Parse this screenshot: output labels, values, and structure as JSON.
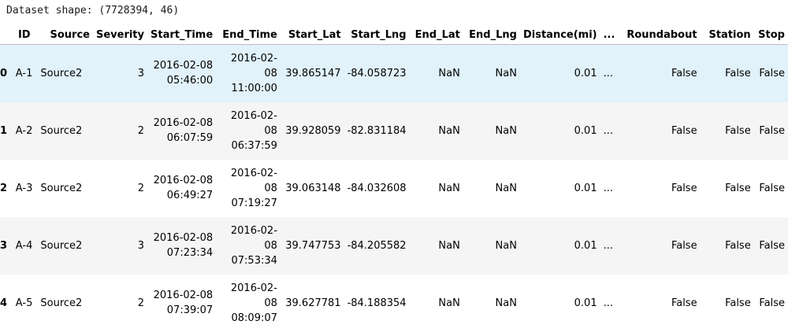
{
  "output": {
    "shape_text": "Dataset shape: (7728394, 46)"
  },
  "table": {
    "columns": [
      "",
      "ID",
      "Source",
      "Severity",
      "Start_Time",
      "End_Time",
      "Start_Lat",
      "Start_Lng",
      "End_Lat",
      "End_Lng",
      "Distance(mi)",
      "...",
      "Roundabout",
      "Station",
      "Stop"
    ],
    "rows": [
      {
        "index": "0",
        "cells": [
          "A-1",
          "Source2",
          "3",
          "2016-02-08 05:46:00",
          "2016-02-08 11:00:00",
          "39.865147",
          "-84.058723",
          "NaN",
          "NaN",
          "0.01",
          "...",
          "False",
          "False",
          "False"
        ]
      },
      {
        "index": "1",
        "cells": [
          "A-2",
          "Source2",
          "2",
          "2016-02-08 06:07:59",
          "2016-02-08 06:37:59",
          "39.928059",
          "-82.831184",
          "NaN",
          "NaN",
          "0.01",
          "...",
          "False",
          "False",
          "False"
        ]
      },
      {
        "index": "2",
        "cells": [
          "A-3",
          "Source2",
          "2",
          "2016-02-08 06:49:27",
          "2016-02-08 07:19:27",
          "39.063148",
          "-84.032608",
          "NaN",
          "NaN",
          "0.01",
          "...",
          "False",
          "False",
          "False"
        ]
      },
      {
        "index": "3",
        "cells": [
          "A-4",
          "Source2",
          "3",
          "2016-02-08 07:23:34",
          "2016-02-08 07:53:34",
          "39.747753",
          "-84.205582",
          "NaN",
          "NaN",
          "0.01",
          "...",
          "False",
          "False",
          "False"
        ]
      },
      {
        "index": "4",
        "cells": [
          "A-5",
          "Source2",
          "2",
          "2016-02-08 07:39:07",
          "2016-02-08 08:09:07",
          "39.627781",
          "-84.188354",
          "NaN",
          "NaN",
          "0.01",
          "...",
          "False",
          "False",
          "False"
        ]
      }
    ]
  },
  "colors": {
    "selected_row": "#e1f2fb",
    "striped_row": "#f5f5f5",
    "header_border": "#bdbdbd"
  }
}
